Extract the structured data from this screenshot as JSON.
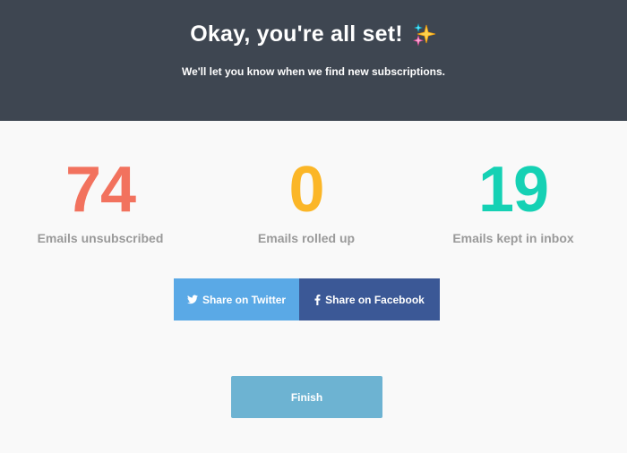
{
  "header": {
    "title": "Okay, you're all set!",
    "title_icon": "sparkles-icon",
    "subtitle": "We'll let you know when we find new subscriptions."
  },
  "stats": [
    {
      "value": "74",
      "label": "Emails unsubscribed",
      "color": "#f2725e"
    },
    {
      "value": "0",
      "label": "Emails rolled up",
      "color": "#fbb627"
    },
    {
      "value": "19",
      "label": "Emails kept in inbox",
      "color": "#15d1b4"
    }
  ],
  "share": {
    "twitter_label": "Share on Twitter",
    "twitter_icon": "twitter-bird-icon",
    "twitter_color": "#5aa9e6",
    "facebook_label": "Share on Facebook",
    "facebook_icon": "facebook-f-icon",
    "facebook_color": "#3b5896"
  },
  "finish": {
    "label": "Finish",
    "color": "#6db3d2"
  },
  "colors": {
    "header_bg": "#3e4651",
    "page_bg": "#f9f9f9",
    "label_gray": "#9a9a9a"
  }
}
